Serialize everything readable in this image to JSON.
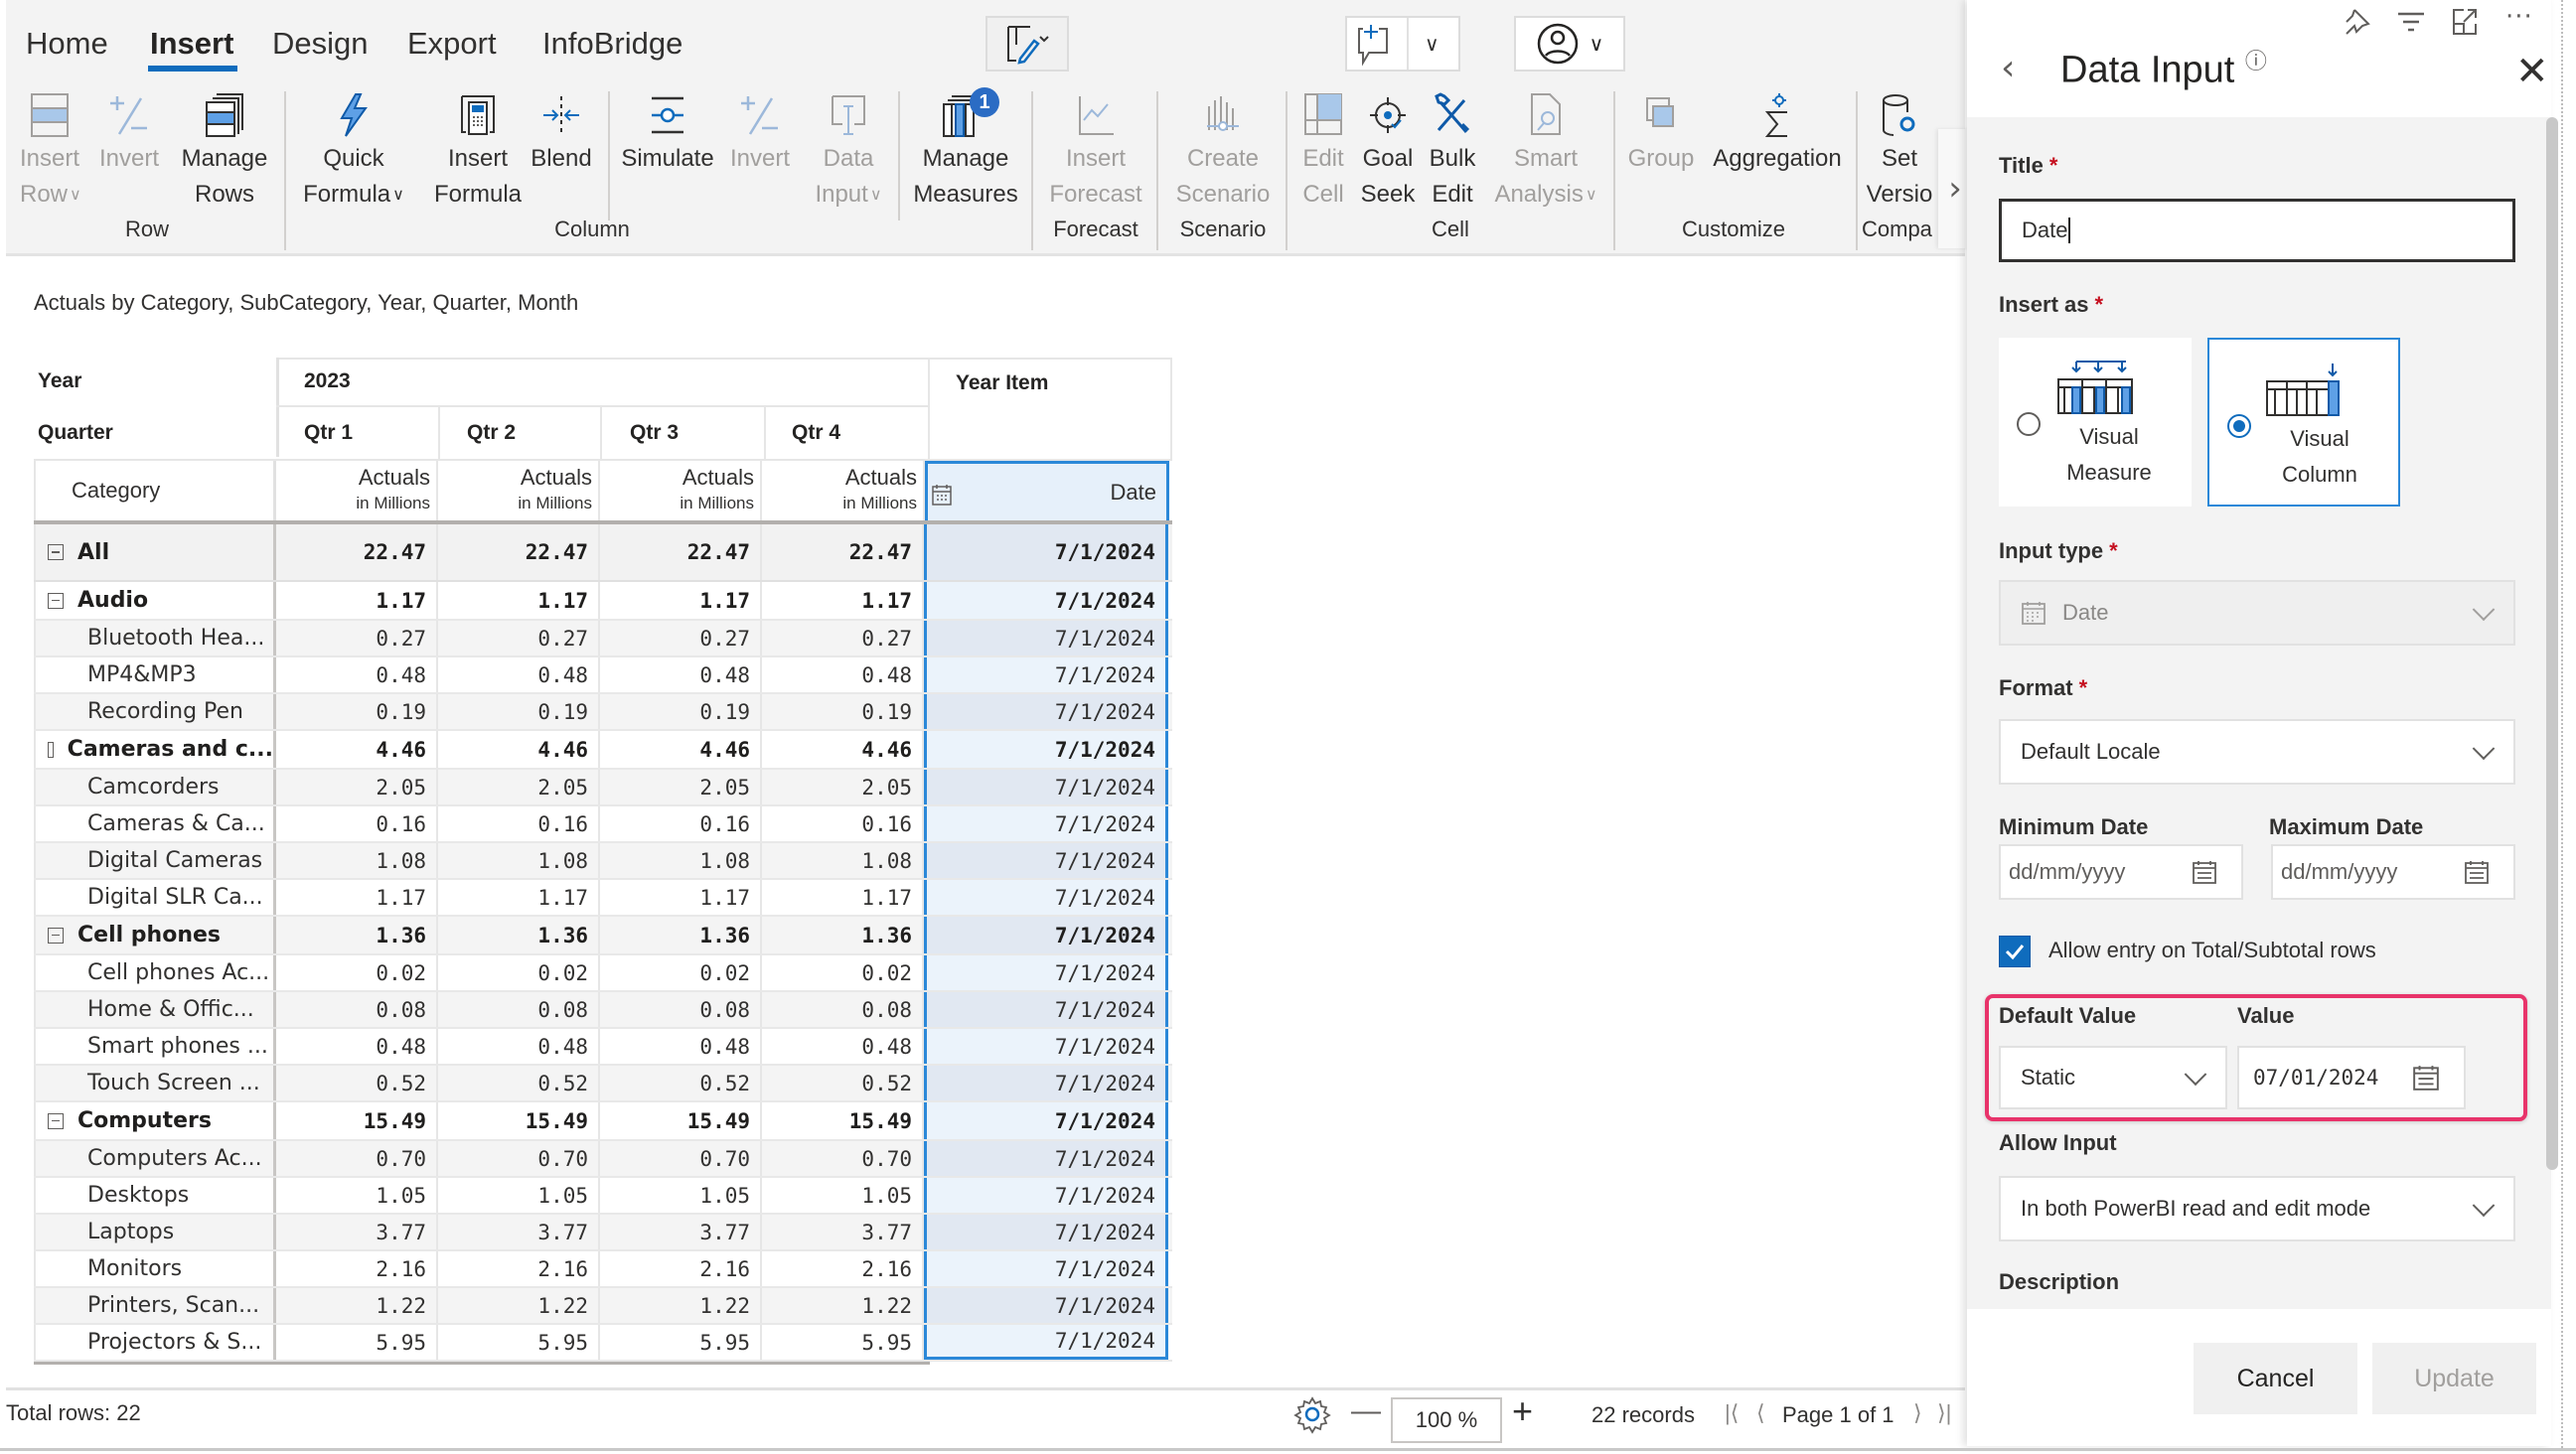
{
  "ribbon": {
    "tabs": [
      {
        "label": "Home",
        "active": false
      },
      {
        "label": "Insert",
        "active": true
      },
      {
        "label": "Design",
        "active": false
      },
      {
        "label": "Export",
        "active": false
      },
      {
        "label": "InfoBridge",
        "active": false
      }
    ],
    "buttons": {
      "insert_row": {
        "line1": "Insert",
        "line2": "Row",
        "enabled": false
      },
      "invert_row": {
        "line1": "Invert",
        "enabled": false
      },
      "manage_rows": {
        "line1": "Manage",
        "line2": "Rows",
        "enabled": true
      },
      "quick_formula": {
        "line1": "Quick",
        "line2": "Formula",
        "enabled": true
      },
      "insert_formula": {
        "line1": "Insert",
        "line2": "Formula",
        "enabled": true
      },
      "blend": {
        "line1": "Blend",
        "enabled": true
      },
      "simulate": {
        "line1": "Simulate",
        "enabled": true
      },
      "invert_col": {
        "line1": "Invert",
        "enabled": false
      },
      "data_input": {
        "line1": "Data",
        "line2": "Input",
        "enabled": false
      },
      "manage_measures": {
        "line1": "Manage",
        "line2": "Measures",
        "badge": "1",
        "enabled": true
      },
      "insert_forecast": {
        "line1": "Insert",
        "line2": "Forecast",
        "enabled": false
      },
      "create_scenario": {
        "line1": "Create",
        "line2": "Scenario",
        "enabled": false
      },
      "edit_cell": {
        "line1": "Edit",
        "line2": "Cell",
        "enabled": false
      },
      "goal_seek": {
        "line1": "Goal",
        "line2": "Seek",
        "enabled": true
      },
      "bulk_edit": {
        "line1": "Bulk",
        "line2": "Edit",
        "enabled": true
      },
      "smart_analysis": {
        "line1": "Smart",
        "line2": "Analysis",
        "enabled": false
      },
      "group": {
        "line1": "Group",
        "enabled": false
      },
      "aggregation": {
        "line1": "Aggregation",
        "enabled": true
      },
      "set_version": {
        "line1": "Set",
        "line2": "Versio",
        "enabled": true
      }
    },
    "groups": {
      "row": "Row",
      "column": "Column",
      "forecast": "Forecast",
      "scenario": "Scenario",
      "cell": "Cell",
      "customize": "Customize",
      "compare": "Compa"
    }
  },
  "report": {
    "subtitle": "Actuals by Category, SubCategory, Year, Quarter, Month",
    "headers": {
      "year_label": "Year",
      "year_value": "2023",
      "year_item": "Year Item",
      "quarter_label": "Quarter",
      "quarters": [
        "Qtr 1",
        "Qtr 2",
        "Qtr 3",
        "Qtr 4"
      ],
      "category_label": "Category",
      "measure": "Actuals",
      "measure_unit": "in Millions",
      "date_col": "Date"
    },
    "rows": [
      {
        "label": "All",
        "level": 0,
        "values": [
          "22.47",
          "22.47",
          "22.47",
          "22.47"
        ],
        "date": "7/1/2024"
      },
      {
        "label": "Audio",
        "level": 1,
        "values": [
          "1.17",
          "1.17",
          "1.17",
          "1.17"
        ],
        "date": "7/1/2024"
      },
      {
        "label": "Bluetooth Hea...",
        "level": 2,
        "values": [
          "0.27",
          "0.27",
          "0.27",
          "0.27"
        ],
        "date": "7/1/2024"
      },
      {
        "label": "MP4&MP3",
        "level": 2,
        "values": [
          "0.48",
          "0.48",
          "0.48",
          "0.48"
        ],
        "date": "7/1/2024"
      },
      {
        "label": "Recording Pen",
        "level": 2,
        "values": [
          "0.19",
          "0.19",
          "0.19",
          "0.19"
        ],
        "date": "7/1/2024"
      },
      {
        "label": "Cameras and c...",
        "level": 1,
        "values": [
          "4.46",
          "4.46",
          "4.46",
          "4.46"
        ],
        "date": "7/1/2024"
      },
      {
        "label": "Camcorders",
        "level": 2,
        "values": [
          "2.05",
          "2.05",
          "2.05",
          "2.05"
        ],
        "date": "7/1/2024"
      },
      {
        "label": "Cameras & Ca...",
        "level": 2,
        "values": [
          "0.16",
          "0.16",
          "0.16",
          "0.16"
        ],
        "date": "7/1/2024"
      },
      {
        "label": "Digital Cameras",
        "level": 2,
        "values": [
          "1.08",
          "1.08",
          "1.08",
          "1.08"
        ],
        "date": "7/1/2024"
      },
      {
        "label": "Digital SLR Ca...",
        "level": 2,
        "values": [
          "1.17",
          "1.17",
          "1.17",
          "1.17"
        ],
        "date": "7/1/2024"
      },
      {
        "label": "Cell phones",
        "level": 1,
        "values": [
          "1.36",
          "1.36",
          "1.36",
          "1.36"
        ],
        "date": "7/1/2024"
      },
      {
        "label": "Cell phones Ac...",
        "level": 2,
        "values": [
          "0.02",
          "0.02",
          "0.02",
          "0.02"
        ],
        "date": "7/1/2024"
      },
      {
        "label": "Home & Offic...",
        "level": 2,
        "values": [
          "0.08",
          "0.08",
          "0.08",
          "0.08"
        ],
        "date": "7/1/2024"
      },
      {
        "label": "Smart phones ...",
        "level": 2,
        "values": [
          "0.48",
          "0.48",
          "0.48",
          "0.48"
        ],
        "date": "7/1/2024"
      },
      {
        "label": "Touch Screen ...",
        "level": 2,
        "values": [
          "0.52",
          "0.52",
          "0.52",
          "0.52"
        ],
        "date": "7/1/2024"
      },
      {
        "label": "Computers",
        "level": 1,
        "values": [
          "15.49",
          "15.49",
          "15.49",
          "15.49"
        ],
        "date": "7/1/2024"
      },
      {
        "label": "Computers Ac...",
        "level": 2,
        "values": [
          "0.70",
          "0.70",
          "0.70",
          "0.70"
        ],
        "date": "7/1/2024"
      },
      {
        "label": "Desktops",
        "level": 2,
        "values": [
          "1.05",
          "1.05",
          "1.05",
          "1.05"
        ],
        "date": "7/1/2024"
      },
      {
        "label": "Laptops",
        "level": 2,
        "values": [
          "3.77",
          "3.77",
          "3.77",
          "3.77"
        ],
        "date": "7/1/2024"
      },
      {
        "label": "Monitors",
        "level": 2,
        "values": [
          "2.16",
          "2.16",
          "2.16",
          "2.16"
        ],
        "date": "7/1/2024"
      },
      {
        "label": "Printers, Scan...",
        "level": 2,
        "values": [
          "1.22",
          "1.22",
          "1.22",
          "1.22"
        ],
        "date": "7/1/2024"
      },
      {
        "label": "Projectors & S...",
        "level": 2,
        "values": [
          "5.95",
          "5.95",
          "5.95",
          "5.95"
        ],
        "date": "7/1/2024"
      }
    ]
  },
  "footer": {
    "total_rows": "Total rows: 22",
    "zoom": "100 %",
    "records": "22 records",
    "page": "Page 1 of 1"
  },
  "panel": {
    "title": "Data Input",
    "title_field": {
      "label": "Title",
      "value": "Date"
    },
    "insert_as": {
      "label": "Insert as",
      "options": [
        {
          "line1": "Visual",
          "line2": "Measure",
          "selected": false
        },
        {
          "line1": "Visual",
          "line2": "Column",
          "selected": true
        }
      ]
    },
    "input_type": {
      "label": "Input type",
      "value": "Date"
    },
    "format": {
      "label": "Format",
      "value": "Default Locale"
    },
    "min_date": {
      "label": "Minimum Date",
      "placeholder": "dd/mm/yyyy"
    },
    "max_date": {
      "label": "Maximum Date",
      "placeholder": "dd/mm/yyyy"
    },
    "allow_total": {
      "label": "Allow entry on Total/Subtotal rows",
      "checked": true
    },
    "default_value": {
      "label": "Default Value",
      "value": "Static"
    },
    "value": {
      "label": "Value",
      "value": "07/01/2024"
    },
    "allow_input": {
      "label": "Allow Input",
      "value": "In both PowerBI read and edit mode"
    },
    "description": {
      "label": "Description"
    },
    "cancel": "Cancel",
    "update": "Update"
  },
  "colors": {
    "accent": "#0f6cbd",
    "highlight": "#e8336a",
    "required": "#c50f1f"
  }
}
